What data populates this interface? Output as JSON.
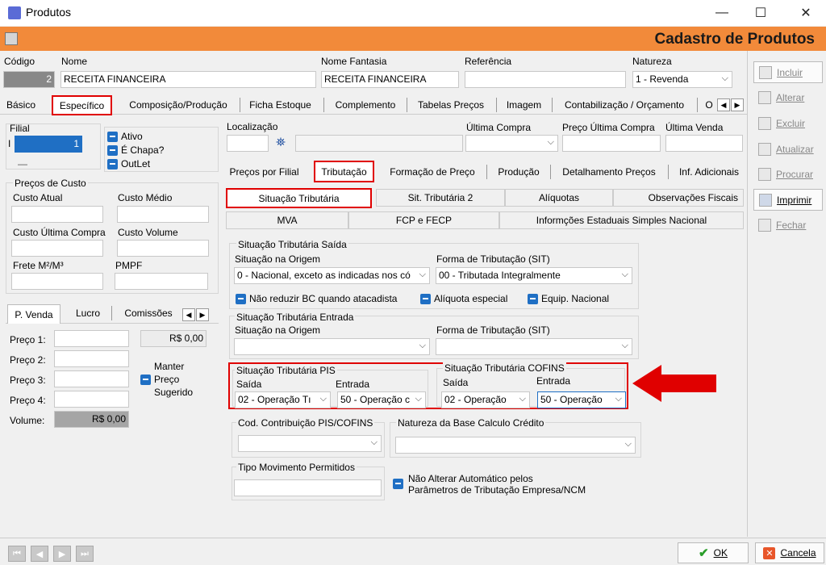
{
  "window": {
    "title": "Produtos",
    "minimize": "—",
    "maximize": "☐",
    "close": "✕"
  },
  "header": {
    "title": "Cadastro de Produtos"
  },
  "fields": {
    "codigo_label": "Código",
    "codigo_value": "2",
    "nome_label": "Nome",
    "nome_value": "RECEITA FINANCEIRA",
    "fantasia_label": "Nome Fantasia",
    "fantasia_value": "RECEITA FINANCEIRA",
    "referencia_label": "Referência",
    "referencia_value": "",
    "natureza_label": "Natureza",
    "natureza_value": "1 - Revenda"
  },
  "main_tabs": [
    "Básico",
    "Específico",
    "Composição/Produção",
    "Ficha Estoque",
    "Complemento",
    "Tabelas Preços",
    "Imagem",
    "Contabilização / Orçamento",
    "O"
  ],
  "filial": {
    "label": "Filial",
    "value": "1",
    "dash": "—"
  },
  "checks": {
    "ativo": "Ativo",
    "chapa": "É Chapa?",
    "outlet": "OutLet"
  },
  "loc": {
    "localizacao": "Localização",
    "ultima_compra": "Última Compra",
    "preco_ultima_compra": "Preço Última Compra",
    "ultima_venda": "Última Venda",
    "binoculars": "⛯"
  },
  "custo": {
    "group": "Preços de Custo",
    "atual": "Custo Atual",
    "medio": "Custo Médio",
    "ultima": "Custo Última Compra",
    "volume": "Custo Volume",
    "frete": "Frete M²/M³",
    "pmpf": "PMPF"
  },
  "venda_tabs": [
    "P. Venda",
    "Lucro",
    "Comissões"
  ],
  "venda": {
    "preco1": "Preço 1:",
    "preco2": "Preço 2:",
    "preco3": "Preço 3:",
    "preco4": "Preço 4:",
    "volume": "Volume:",
    "preco1_value": "R$ 0,00",
    "volume_value": "R$ 0,00",
    "manter": "Manter",
    "preco": "Preço",
    "sugerido": "Sugerido"
  },
  "sub_tabs": [
    "Preços por Filial",
    "Tributação",
    "Formação de Preço",
    "Produção",
    "Detalhamento Preços",
    "Inf. Adicionais"
  ],
  "trib_tabs_row1": [
    "Situação Tributária",
    "Sit. Tributária 2",
    "Alíquotas",
    "Observações Fiscais"
  ],
  "trib_tabs_row2": [
    "MVA",
    "FCP e FECP",
    "Informções Estaduais Simples Nacional"
  ],
  "saida": {
    "group": "Situação Tributária Saída",
    "origem_label": "Situação na Origem",
    "origem_value": "0 - Nacional, exceto as indicadas nos có",
    "forma_label": "Forma de Tributação (SIT)",
    "forma_value": "00 - Tributada Integralmente",
    "nao_reduzir": "Não reduzir BC quando atacadista",
    "aliquota_especial": "Alíquota especial",
    "equip_nacional": "Equip. Nacional"
  },
  "entrada": {
    "group": "Situação Tributária Entrada",
    "origem_label": "Situação na Origem",
    "forma_label": "Forma de Tributação (SIT)"
  },
  "pis": {
    "group": "Situação Tributária PIS",
    "saida_label": "Saída",
    "entrada_label": "Entrada",
    "saida_value": "02 - Operação Tı",
    "entrada_value": "50 - Operação c"
  },
  "cofins": {
    "group": "Situação Tributária COFINS",
    "saida_label": "Saída",
    "entrada_label": "Entrada",
    "saida_value": "02 - Operação",
    "entrada_value": "50 - Operação"
  },
  "cod_contrib": "Cod. Contribuição PIS/COFINS",
  "natureza_base": "Natureza da Base Calculo Crédito",
  "tipo_mov": "Tipo Movimento Permitidos",
  "nao_alterar_1": "Não Alterar Automático pelos",
  "nao_alterar_2": "Parâmetros de Tributação Empresa/NCM",
  "right_buttons": [
    "Incluir",
    "Alterar",
    "Excluir",
    "Atualizar",
    "Procurar",
    "Imprimir",
    "Fechar"
  ],
  "bottom": {
    "ok": "OK",
    "cancel": "Cancela"
  },
  "colors": {
    "accent_orange": "#f28a3a",
    "highlight_red": "#e00000",
    "checkbox_blue": "#1f6fc4"
  }
}
